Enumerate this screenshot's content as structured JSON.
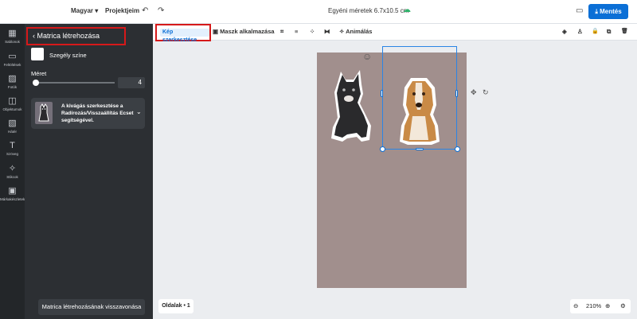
{
  "topbar": {
    "language": "Magyar ▾",
    "projects": "Projektjeim",
    "undo_icon": "↶",
    "redo_icon": "↷",
    "doc_title": "Egyéni méretek 6.7x10.5 cm",
    "cloud_icon": "☁",
    "comment_icon": "▭",
    "save_label": "⤓ Mentés"
  },
  "rail": [
    {
      "icon": "▦",
      "label": "Sablonok"
    },
    {
      "icon": "▭",
      "label": "Feltöltések"
    },
    {
      "icon": "▨",
      "label": "Fotók"
    },
    {
      "icon": "◫",
      "label": "Objektumok"
    },
    {
      "icon": "▧",
      "label": "Hátér"
    },
    {
      "icon": "T",
      "label": "Szöveg"
    },
    {
      "icon": "✧",
      "label": "Stikcok"
    },
    {
      "icon": "▣",
      "label": "Márkakészletek"
    }
  ],
  "panel": {
    "back_label": "Matrica létrehozása",
    "border_color_label": "Szegély színe",
    "size_label": "Méret",
    "size_value": "4",
    "size_fraction": 0.0,
    "info_text": "A kivágás szerkesztése a Radírozás/Visszaállítás Ecset segítségével.",
    "info_chevron": "⌄",
    "undo_label": "Matrica létrehozásának visszavonása"
  },
  "toolbar": {
    "edit_image": "Kép szerkesztése",
    "mask": "▣ Maszk alkalmazása",
    "crop_icon": "⌗",
    "lines_icon": "≡",
    "pattern_icon": "⁘",
    "flip_icon": "⧓",
    "animate": "✧  Animálás",
    "layers_icon": "◈",
    "people_icon": "♙",
    "lock_icon": "🔒",
    "copy_icon": "⧉",
    "delete_icon": "🗑"
  },
  "canvas": {
    "move_icon": "✥",
    "rotate_icon": "↻",
    "face_icon": "☺"
  },
  "footer": {
    "pages_label": "Oldalak • 1",
    "zoom_out_icon": "⊖",
    "zoom_value": "210%",
    "zoom_in_icon": "⊕",
    "settings_icon": "⚙"
  },
  "colors": {
    "accent": "#0b6fd6",
    "highlight_box": "#d6191a",
    "artboard": "#a18f8d",
    "panel": "#2c2f33"
  }
}
